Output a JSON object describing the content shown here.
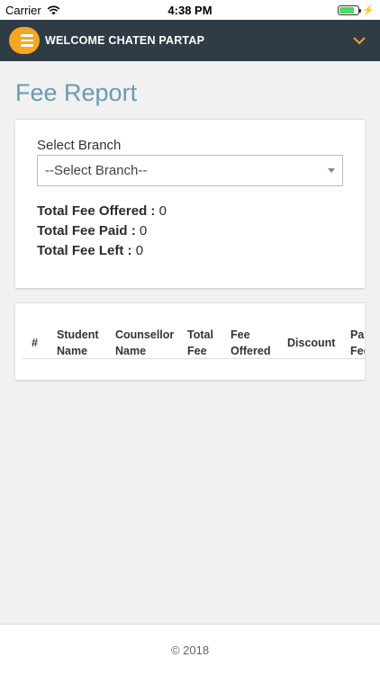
{
  "status_bar": {
    "carrier": "Carrier",
    "time": "4:38 PM"
  },
  "header": {
    "welcome": "WELCOME CHATEN PARTAP",
    "accent": "#f5a623",
    "bar_color": "#2f3b45"
  },
  "page": {
    "title": "Fee Report"
  },
  "filter": {
    "branch_label": "Select Branch",
    "branch_selected": "--Select Branch--"
  },
  "totals": {
    "offered_label": "Total Fee Offered :",
    "offered_value": "0",
    "paid_label": "Total Fee Paid :",
    "paid_value": "0",
    "left_label": "Total Fee Left :",
    "left_value": "0"
  },
  "table": {
    "columns": [
      {
        "line1": "#",
        "line2": ""
      },
      {
        "line1": "Student",
        "line2": "Name"
      },
      {
        "line1": "Counsellor",
        "line2": "Name"
      },
      {
        "line1": "Total",
        "line2": "Fee"
      },
      {
        "line1": "Fee",
        "line2": "Offered"
      },
      {
        "line1": "Discount",
        "line2": ""
      },
      {
        "line1": "Paid",
        "line2": "Fee"
      }
    ]
  },
  "footer": {
    "copyright": "© 2018"
  }
}
